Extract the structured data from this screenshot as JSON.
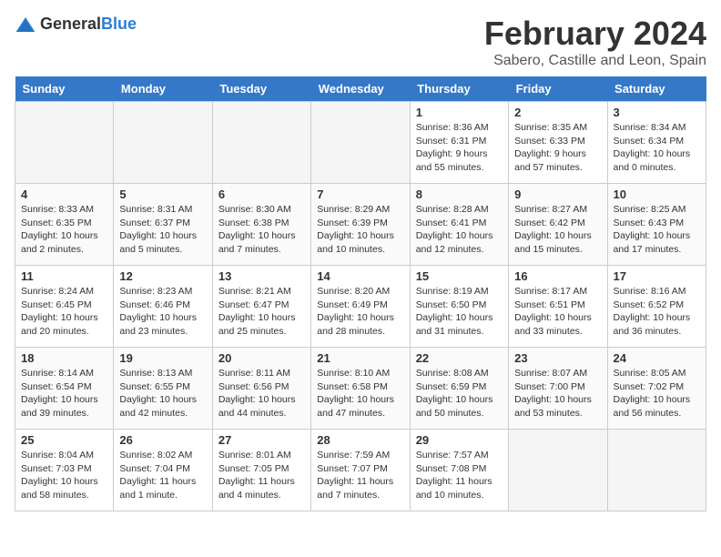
{
  "header": {
    "logo_general": "General",
    "logo_blue": "Blue",
    "month_title": "February 2024",
    "location": "Sabero, Castille and Leon, Spain"
  },
  "weekdays": [
    "Sunday",
    "Monday",
    "Tuesday",
    "Wednesday",
    "Thursday",
    "Friday",
    "Saturday"
  ],
  "weeks": [
    [
      {
        "day": "",
        "info": ""
      },
      {
        "day": "",
        "info": ""
      },
      {
        "day": "",
        "info": ""
      },
      {
        "day": "",
        "info": ""
      },
      {
        "day": "1",
        "info": "Sunrise: 8:36 AM\nSunset: 6:31 PM\nDaylight: 9 hours\nand 55 minutes."
      },
      {
        "day": "2",
        "info": "Sunrise: 8:35 AM\nSunset: 6:33 PM\nDaylight: 9 hours\nand 57 minutes."
      },
      {
        "day": "3",
        "info": "Sunrise: 8:34 AM\nSunset: 6:34 PM\nDaylight: 10 hours\nand 0 minutes."
      }
    ],
    [
      {
        "day": "4",
        "info": "Sunrise: 8:33 AM\nSunset: 6:35 PM\nDaylight: 10 hours\nand 2 minutes."
      },
      {
        "day": "5",
        "info": "Sunrise: 8:31 AM\nSunset: 6:37 PM\nDaylight: 10 hours\nand 5 minutes."
      },
      {
        "day": "6",
        "info": "Sunrise: 8:30 AM\nSunset: 6:38 PM\nDaylight: 10 hours\nand 7 minutes."
      },
      {
        "day": "7",
        "info": "Sunrise: 8:29 AM\nSunset: 6:39 PM\nDaylight: 10 hours\nand 10 minutes."
      },
      {
        "day": "8",
        "info": "Sunrise: 8:28 AM\nSunset: 6:41 PM\nDaylight: 10 hours\nand 12 minutes."
      },
      {
        "day": "9",
        "info": "Sunrise: 8:27 AM\nSunset: 6:42 PM\nDaylight: 10 hours\nand 15 minutes."
      },
      {
        "day": "10",
        "info": "Sunrise: 8:25 AM\nSunset: 6:43 PM\nDaylight: 10 hours\nand 17 minutes."
      }
    ],
    [
      {
        "day": "11",
        "info": "Sunrise: 8:24 AM\nSunset: 6:45 PM\nDaylight: 10 hours\nand 20 minutes."
      },
      {
        "day": "12",
        "info": "Sunrise: 8:23 AM\nSunset: 6:46 PM\nDaylight: 10 hours\nand 23 minutes."
      },
      {
        "day": "13",
        "info": "Sunrise: 8:21 AM\nSunset: 6:47 PM\nDaylight: 10 hours\nand 25 minutes."
      },
      {
        "day": "14",
        "info": "Sunrise: 8:20 AM\nSunset: 6:49 PM\nDaylight: 10 hours\nand 28 minutes."
      },
      {
        "day": "15",
        "info": "Sunrise: 8:19 AM\nSunset: 6:50 PM\nDaylight: 10 hours\nand 31 minutes."
      },
      {
        "day": "16",
        "info": "Sunrise: 8:17 AM\nSunset: 6:51 PM\nDaylight: 10 hours\nand 33 minutes."
      },
      {
        "day": "17",
        "info": "Sunrise: 8:16 AM\nSunset: 6:52 PM\nDaylight: 10 hours\nand 36 minutes."
      }
    ],
    [
      {
        "day": "18",
        "info": "Sunrise: 8:14 AM\nSunset: 6:54 PM\nDaylight: 10 hours\nand 39 minutes."
      },
      {
        "day": "19",
        "info": "Sunrise: 8:13 AM\nSunset: 6:55 PM\nDaylight: 10 hours\nand 42 minutes."
      },
      {
        "day": "20",
        "info": "Sunrise: 8:11 AM\nSunset: 6:56 PM\nDaylight: 10 hours\nand 44 minutes."
      },
      {
        "day": "21",
        "info": "Sunrise: 8:10 AM\nSunset: 6:58 PM\nDaylight: 10 hours\nand 47 minutes."
      },
      {
        "day": "22",
        "info": "Sunrise: 8:08 AM\nSunset: 6:59 PM\nDaylight: 10 hours\nand 50 minutes."
      },
      {
        "day": "23",
        "info": "Sunrise: 8:07 AM\nSunset: 7:00 PM\nDaylight: 10 hours\nand 53 minutes."
      },
      {
        "day": "24",
        "info": "Sunrise: 8:05 AM\nSunset: 7:02 PM\nDaylight: 10 hours\nand 56 minutes."
      }
    ],
    [
      {
        "day": "25",
        "info": "Sunrise: 8:04 AM\nSunset: 7:03 PM\nDaylight: 10 hours\nand 58 minutes."
      },
      {
        "day": "26",
        "info": "Sunrise: 8:02 AM\nSunset: 7:04 PM\nDaylight: 11 hours\nand 1 minute."
      },
      {
        "day": "27",
        "info": "Sunrise: 8:01 AM\nSunset: 7:05 PM\nDaylight: 11 hours\nand 4 minutes."
      },
      {
        "day": "28",
        "info": "Sunrise: 7:59 AM\nSunset: 7:07 PM\nDaylight: 11 hours\nand 7 minutes."
      },
      {
        "day": "29",
        "info": "Sunrise: 7:57 AM\nSunset: 7:08 PM\nDaylight: 11 hours\nand 10 minutes."
      },
      {
        "day": "",
        "info": ""
      },
      {
        "day": "",
        "info": ""
      }
    ]
  ]
}
